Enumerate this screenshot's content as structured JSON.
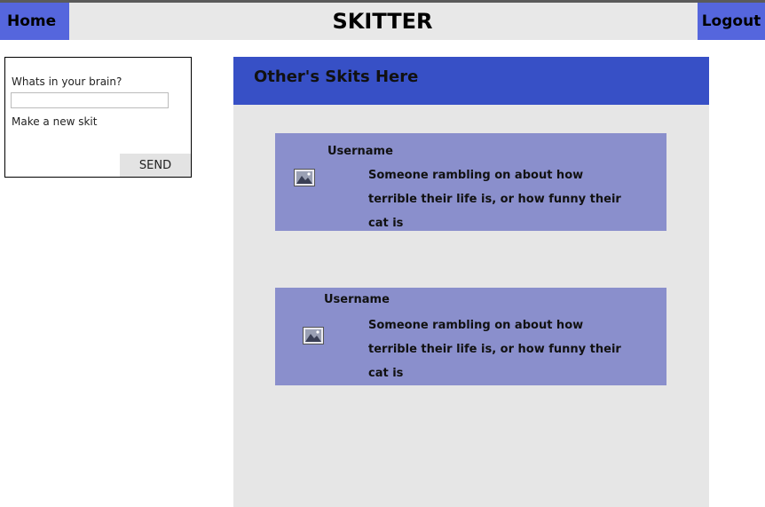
{
  "header": {
    "home_label": "Home",
    "title": "SKITTER",
    "logout_label": "Logout"
  },
  "compose": {
    "prompt_label": "Whats in your brain?",
    "input_value": "",
    "input_placeholder": "",
    "hint": "Make a new skit",
    "send_label": "SEND"
  },
  "feed": {
    "heading": "Other's Skits Here",
    "skits": [
      {
        "username": "Username",
        "text": "Someone rambling on about how terrible their life is, or how funny their cat is",
        "image_icon": "image-placeholder-icon"
      },
      {
        "username": "Username",
        "text": "Someone rambling on about how terrible their life is, or how funny their cat is",
        "image_icon": "image-placeholder-icon"
      }
    ]
  },
  "colors": {
    "accent": "#5566dd",
    "feed_header": "#3750c6",
    "skit_card": "#8a8fcc",
    "panel_bg": "#e6e6e6"
  }
}
